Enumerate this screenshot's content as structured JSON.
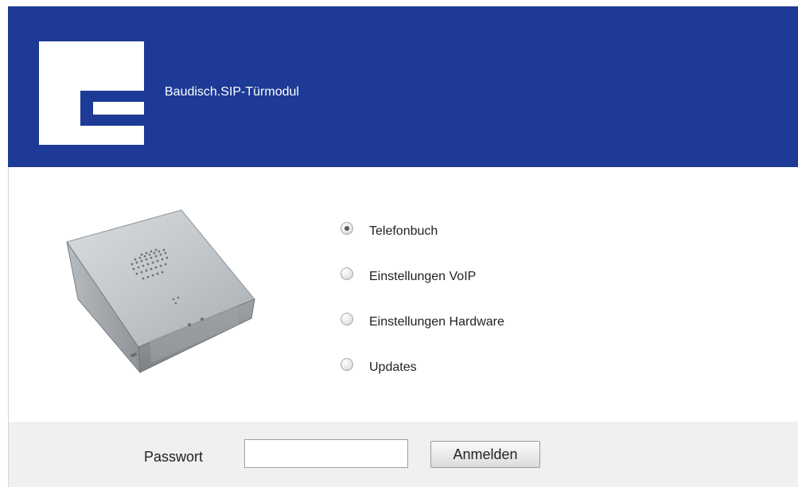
{
  "header": {
    "title": "Baudisch.SIP-Türmodul",
    "background_color": "#1d3a96"
  },
  "logo": {
    "icon": "baudisch-logo"
  },
  "device_image": {
    "icon": "door-speaker-module-image"
  },
  "menu": {
    "options": [
      {
        "label": "Telefonbuch",
        "checked": true
      },
      {
        "label": "Einstellungen VoIP",
        "checked": false
      },
      {
        "label": "Einstellungen Hardware",
        "checked": false
      },
      {
        "label": "Updates",
        "checked": false
      }
    ]
  },
  "login": {
    "password_label": "Passwort",
    "password_value": "",
    "submit_label": "Anmelden"
  }
}
